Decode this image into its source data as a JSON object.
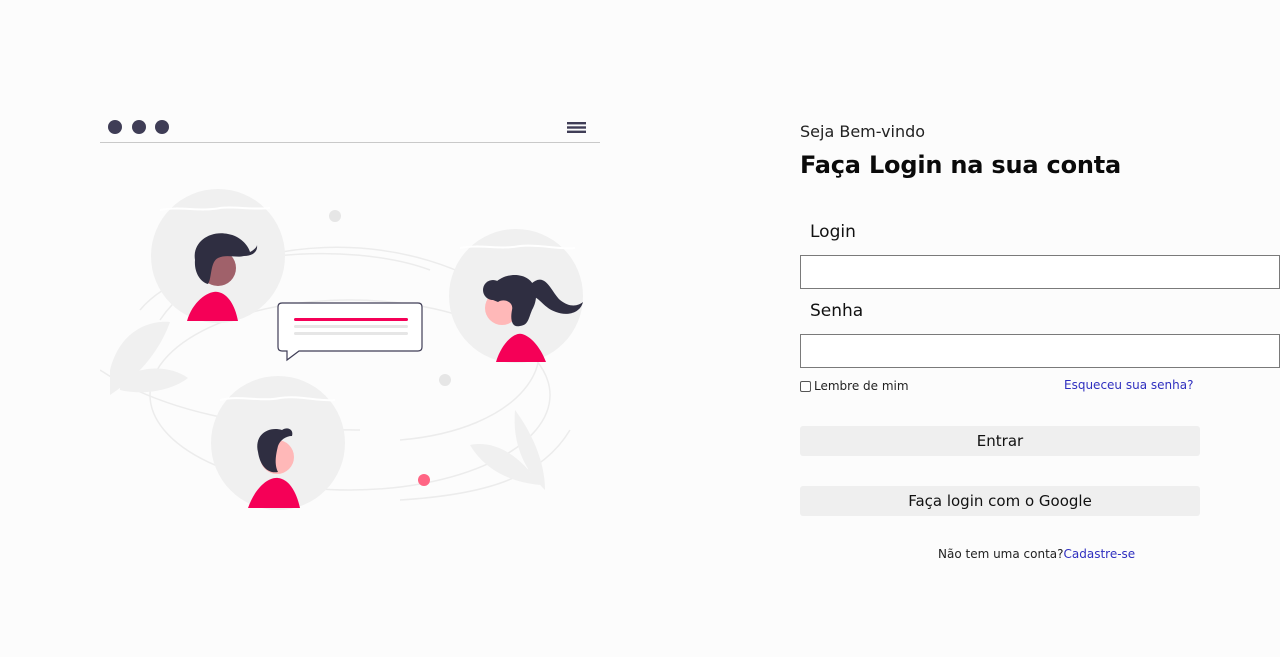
{
  "illustration": {
    "window_dots": 3,
    "colors": {
      "dark": "#3f3d56",
      "accent": "#f50057",
      "skin": "#ffb8b8",
      "skin_dark": "#a0616a",
      "hair": "#2f2e41",
      "bg_circle": "#f0f0f0",
      "light_line": "#e6e6e6",
      "pink_dot": "#ff6584"
    },
    "icons": [
      "window-dot-icon",
      "hamburger-menu-icon",
      "chat-bubble-icon",
      "person-avatar-icon"
    ]
  },
  "login": {
    "welcome": "Seja Bem-vindo",
    "title": "Faça Login na sua conta",
    "login_label": "Login",
    "login_value": "",
    "password_label": "Senha",
    "password_value": "",
    "remember_label": "Lembre de mim",
    "remember_checked": false,
    "forgot_link": "Esqueceu sua senha?",
    "enter_button": "Entrar",
    "google_button": "Faça login com o Google",
    "no_account_text": "Não tem uma conta?",
    "signup_link": "Cadastre-se"
  },
  "theme": {
    "background": "#fcfcfc",
    "link_color": "#2f2fbf",
    "button_bg": "#efefef",
    "input_border": "#7a7a7a"
  }
}
